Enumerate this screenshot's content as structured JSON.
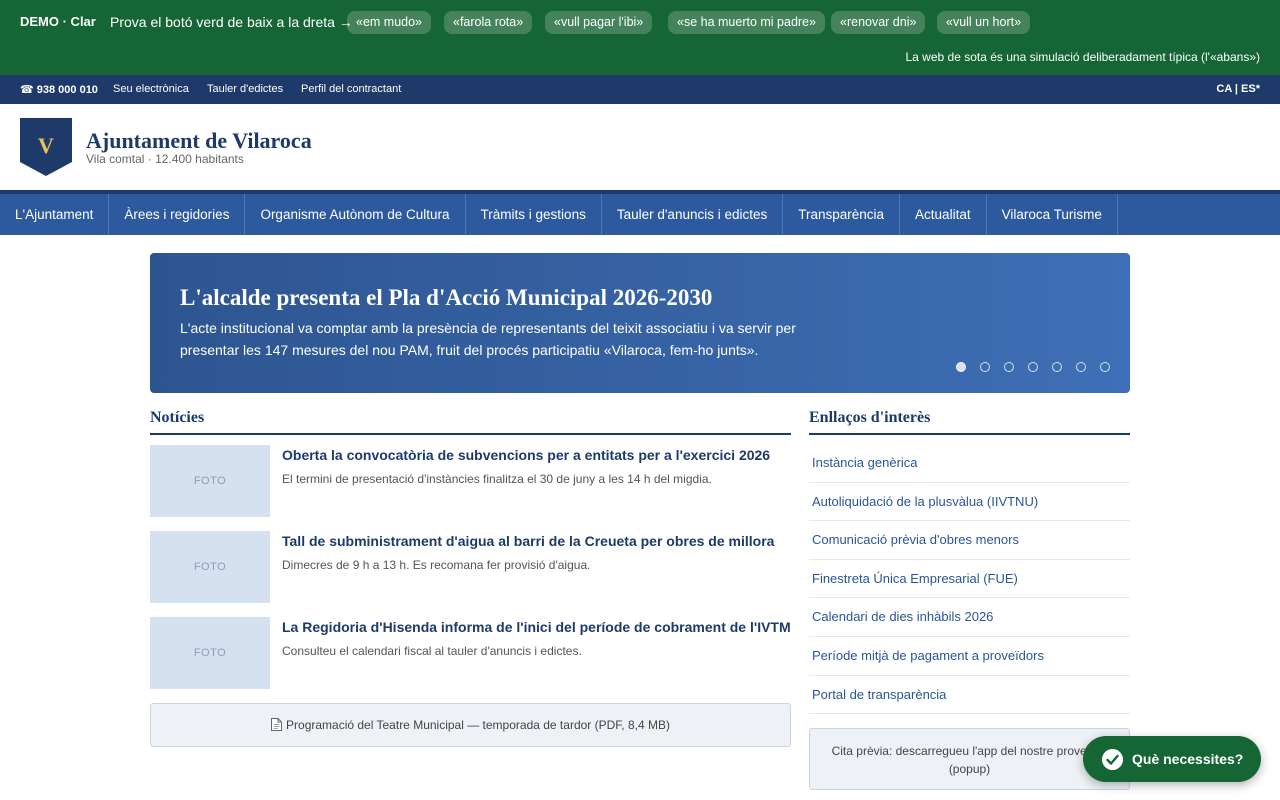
{
  "demo": {
    "brand": "DEMO · Clar",
    "prompt": "Prova el botó verd de baix a la dreta →",
    "chips": [
      "«em mudo»",
      "«farola rota»",
      "«vull pagar l'ibi»",
      "«se ha muerto mi padre»",
      "«renovar dni»",
      "«vull un hort»"
    ],
    "note": "La web de sota és una simulació deliberadament típica (l'«abans»)"
  },
  "topbar": {
    "phone": "☎ 938 000 010",
    "links": [
      "Seu electrònica",
      "Tauler d'edictes",
      "Perfil del contractant"
    ],
    "languages": "CA | ES*"
  },
  "header": {
    "shield_letter": "V",
    "title": "Ajuntament de Vilaroca",
    "subtitle": "Vila comtal · 12.400 habitants"
  },
  "nav": {
    "items": [
      "L'Ajuntament",
      "Àrees i regidories",
      "Organisme Autònom de Cultura",
      "Tràmits i gestions",
      "Tauler d'anuncis i edictes",
      "Transparència",
      "Actualitat",
      "Vilaroca Turisme"
    ]
  },
  "hero": {
    "title": "L'alcalde presenta el Pla d'Acció Municipal 2026-2030",
    "text": "L'acte institucional va comptar amb la presència de representants del teixit associatiu i va servir per presentar les 147 mesures del nou PAM, fruit del procés participatiu «Vilaroca, fem-ho junts».",
    "slide_count": 7,
    "active_slide": 1
  },
  "news": {
    "heading": "Notícies",
    "photo_label": "FOTO",
    "items": [
      {
        "title": "Oberta la convocatòria de subvencions per a entitats per a l'exercici 2026",
        "desc": "El termini de presentació d'instàncies finalitza el 30 de juny a les 14 h del migdia."
      },
      {
        "title": "Tall de subministrament d'aigua al barri de la Creueta per obres de millora",
        "desc": "Dimecres de 9 h a 13 h. Es recomana fer provisió d'aigua."
      },
      {
        "title": "La Regidoria d'Hisenda informa de l'inici del període de cobrament de l'IVTM",
        "desc": "Consulteu el calendari fiscal al tauler d'anuncis i edictes."
      }
    ],
    "pdf_icon": "document-icon",
    "pdf_label": "Programació del Teatre Municipal — temporada de tardor (PDF, 8,4 MB)"
  },
  "links": {
    "heading": "Enllaços d'interès",
    "items": [
      "Instància genèrica",
      "Autoliquidació de la plusvàlua (IIVTNU)",
      "Comunicació prèvia d'obres menors",
      "Finestreta Única Empresarial (FUE)",
      "Calendari de dies inhàbils 2026",
      "Període mitjà de pagament a proveïdors",
      "Portal de transparència"
    ],
    "popup_text": "Cita prèvia: descarregueu l'app del nostre proveïdor (popup)"
  },
  "cta": {
    "label": "Què necessites?",
    "icon": "check-icon"
  },
  "colors": {
    "demo_green": "#166534",
    "navy": "#1e3a6b",
    "nav_blue": "#2d5a9e",
    "gold": "#e8c25a"
  }
}
